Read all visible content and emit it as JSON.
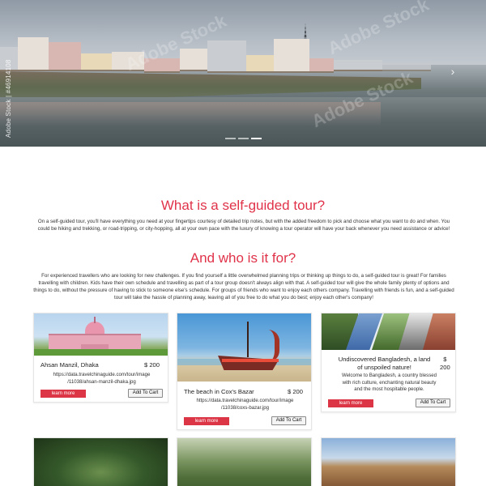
{
  "hero": {
    "watermark": "Adobe Stock | #46914108",
    "faint_marks": [
      "Adobe Stock",
      "Adobe Stock",
      "Adobe Stock"
    ],
    "next_glyph": "›",
    "slides_count": 3,
    "active_slide": 3
  },
  "section1": {
    "title": "What is a self-guided tour?",
    "body": "On a self-guided tour, you'll have everything you need at your fingertips courtesy of detailed trip notes, but with the added freedom to pick and choose what you want to do and when. You could be hiking and trekking, or road-tripping, or city-hopping, all at your own pace with the luxury of knowing a tour operator will have your back whenever you need assistance or advice!"
  },
  "section2": {
    "title": "And who is it for?",
    "body": "For experienced travellers who are looking for new challenges. If you find yourself a little overwhelmed planning trips or thinking up things to do, a self-guided tour is great! For families travelling with children. Kids have their own schedule and travelling as part of a tour group doesn't always align with that. A self-guided tour will give the whole family plenty of options and things to do, without the pressure of having to stick to someone else's schedule. For groups of friends who want to enjoy each others company. Travelling with friends is fun, and a self-guided tour will take the hassle of planning away, leaving all of you free to do what you do best; enjoy each other's company!"
  },
  "cards": [
    {
      "title": "Ahsan Manzil, Dhaka",
      "price": "$ 200",
      "path": "https://data.travelchinaguide.com/tour/image/11038/ahsan-manzil-dhaka.jpg",
      "path_line1": "https://data.travelchinaguide.com/tour/image",
      "path_line2": "/11038/ahsan-manzil-dhaka.jpg",
      "more_label": "learn more",
      "cart_label": "Add To Cart"
    },
    {
      "title": "The beach in Cox's Bazar",
      "price": "$ 200",
      "path_line1": "https://data.travelchinaguide.com/tour/image",
      "path_line2": "/11038/coxs-bazar.jpg",
      "more_label": "learn more",
      "cart_label": "Add To Cart"
    },
    {
      "title_line1": "Undiscovered Bangladesh, a land",
      "title_line2": "of unspoiled nature!",
      "price_line1": "$",
      "price_line2": "200",
      "desc_line1": "Welcome to Bangladesh, a country blessed",
      "desc_line2": "with rich culture, enchanting natural beauty",
      "desc_line3": "and the most hospitable people.",
      "more_label": "learn more",
      "cart_label": "Add To Cart"
    }
  ],
  "colors": {
    "accent": "#e0334a",
    "button": "#dc3545"
  }
}
